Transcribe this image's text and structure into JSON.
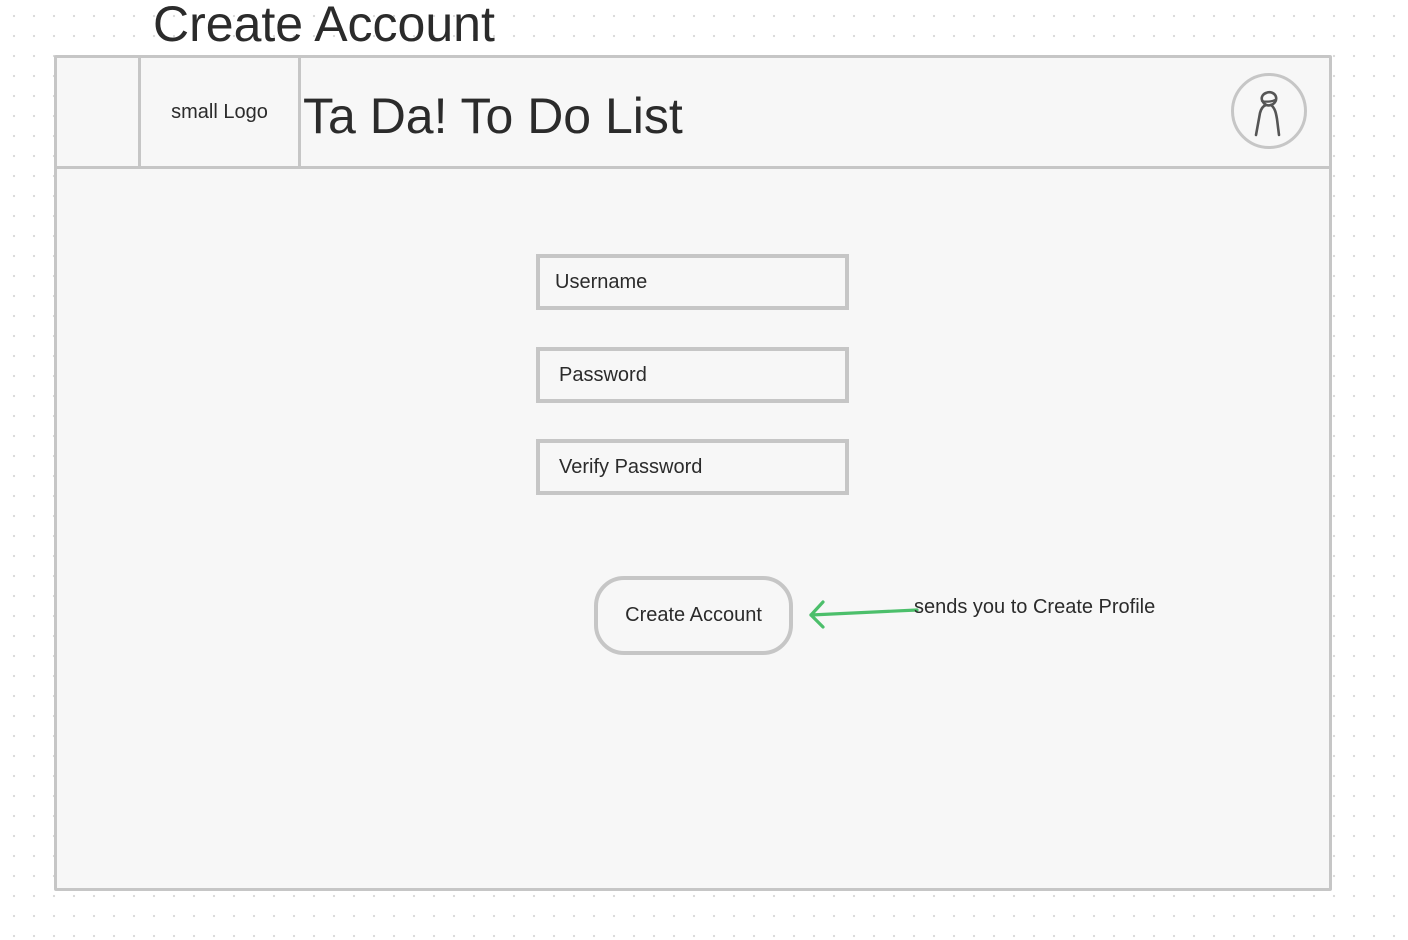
{
  "frame_title": "Create Account",
  "header": {
    "logo_text": "small Logo",
    "app_title": "Ta Da! To Do List",
    "avatar_icon": "user-avatar-icon"
  },
  "form": {
    "username_placeholder": "Username",
    "password_placeholder": "Password",
    "verify_password_placeholder": "Verify Password",
    "submit_label": "Create Account"
  },
  "annotation": {
    "text": "sends you to Create Profile",
    "arrow_color": "#4cbf6b"
  },
  "colors": {
    "border": "#c6c6c6",
    "frame_background": "#f7f7f7",
    "text": "#2b2b2b"
  }
}
